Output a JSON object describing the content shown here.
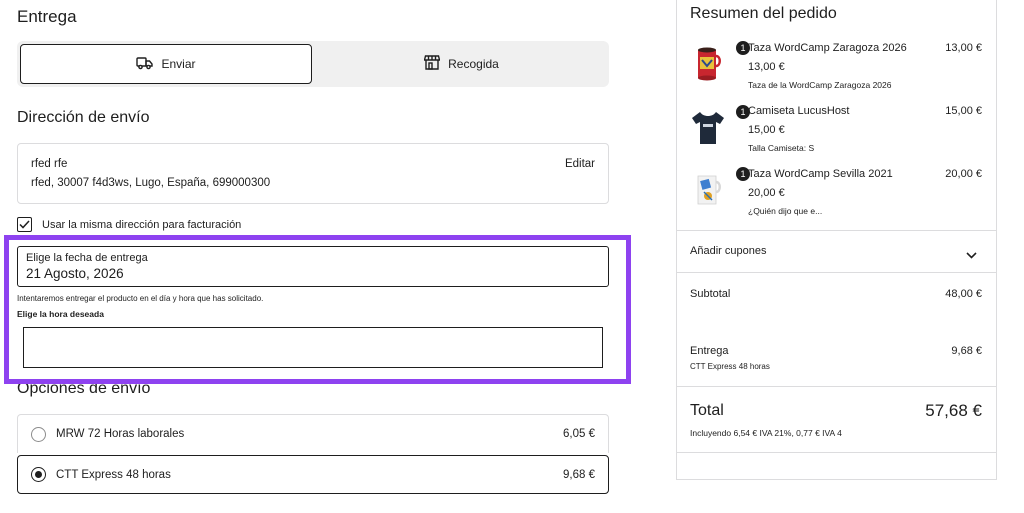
{
  "delivery": {
    "heading": "Entrega",
    "ship_label": "Enviar",
    "pickup_label": "Recogida"
  },
  "address": {
    "heading": "Dirección de envío",
    "name": "rfed rfe",
    "line": "rfed, 30007 f4d3ws, Lugo, España, 699000300",
    "edit_label": "Editar",
    "billing_same_label": "Usar la misma dirección para facturación",
    "billing_same_checked": true
  },
  "delivery_date": {
    "label": "Elige la fecha de entrega",
    "value": "21 Agosto, 2026",
    "help": "Intentaremos entregar el producto en el día y hora que has solicitado.",
    "time_label": "Elige la hora deseada",
    "time_value": ""
  },
  "shipping_options": {
    "heading": "Opciones de envío",
    "options": [
      {
        "name": "MRW 72 Horas laborales",
        "price": "6,05 €",
        "selected": false
      },
      {
        "name": "CTT Express 48 horas",
        "price": "9,68 €",
        "selected": true
      }
    ]
  },
  "summary": {
    "title": "Resumen del pedido",
    "items": [
      {
        "qty": "1",
        "name": "Taza WordCamp Zaragoza 2026",
        "unit_price": "13,00 €",
        "meta": "Taza de la WordCamp Zaragoza 2026",
        "total": "13,00 €"
      },
      {
        "qty": "1",
        "name": "Camiseta LucusHost",
        "unit_price": "15,00 €",
        "meta": "Talla Camiseta: S",
        "total": "15,00 €"
      },
      {
        "qty": "1",
        "name": "Taza WordCamp Sevilla 2021",
        "unit_price": "20,00 €",
        "meta": "¿Quién dijo que e...",
        "total": "20,00 €"
      }
    ],
    "coupon_label": "Añadir cupones",
    "subtotal_label": "Subtotal",
    "subtotal_value": "48,00 €",
    "delivery_label": "Entrega",
    "delivery_method": "CTT Express 48 horas",
    "delivery_value": "9,68 €",
    "total_label": "Total",
    "total_value": "57,68 €",
    "tax_note": "Incluyendo 6,54 € IVA 21%, 0,77 € IVA 4"
  },
  "colors": {
    "highlight": "#8e42f0",
    "text": "#1e1e1e",
    "border": "#dcdcde"
  }
}
